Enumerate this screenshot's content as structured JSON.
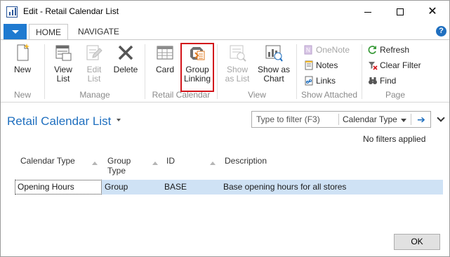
{
  "window": {
    "title": "Edit - Retail Calendar List"
  },
  "tabs": [
    {
      "label": "HOME"
    },
    {
      "label": "NAVIGATE"
    }
  ],
  "help_glyph": "?",
  "ribbon": {
    "groups": {
      "new": {
        "label": "New",
        "buttons": {
          "new": "New"
        }
      },
      "manage": {
        "label": "Manage",
        "buttons": {
          "view_list": "View\nList",
          "edit_list": "Edit\nList",
          "delete": "Delete"
        }
      },
      "retail_calendar": {
        "label": "Retail Calendar",
        "buttons": {
          "card": "Card",
          "group_linking": "Group\nLinking"
        }
      },
      "view": {
        "label": "View",
        "buttons": {
          "show_as_list": "Show\nas List",
          "show_as_chart": "Show as\nChart"
        }
      },
      "show_attached": {
        "label": "Show Attached",
        "buttons": {
          "onenote": "OneNote",
          "notes": "Notes",
          "links": "Links"
        }
      },
      "page": {
        "label": "Page",
        "buttons": {
          "refresh": "Refresh",
          "clear_filter": "Clear Filter",
          "find": "Find"
        }
      }
    }
  },
  "list": {
    "title": "Retail Calendar List",
    "filter": {
      "placeholder": "Type to filter (F3)",
      "field": "Calendar Type"
    },
    "no_filters": "No filters applied",
    "columns": [
      "Calendar Type",
      "Group\nType",
      "ID",
      "Description"
    ],
    "rows": [
      {
        "calendar_type": "Opening Hours",
        "group_type": "Group",
        "id": "BASE",
        "description": "Base opening hours for all stores"
      }
    ]
  },
  "ok_label": "OK",
  "colors": {
    "accent": "#1f6fbf",
    "file_tab": "#1f7ad0",
    "selection": "#cfe2f5",
    "highlight_box": "#d3151b"
  }
}
